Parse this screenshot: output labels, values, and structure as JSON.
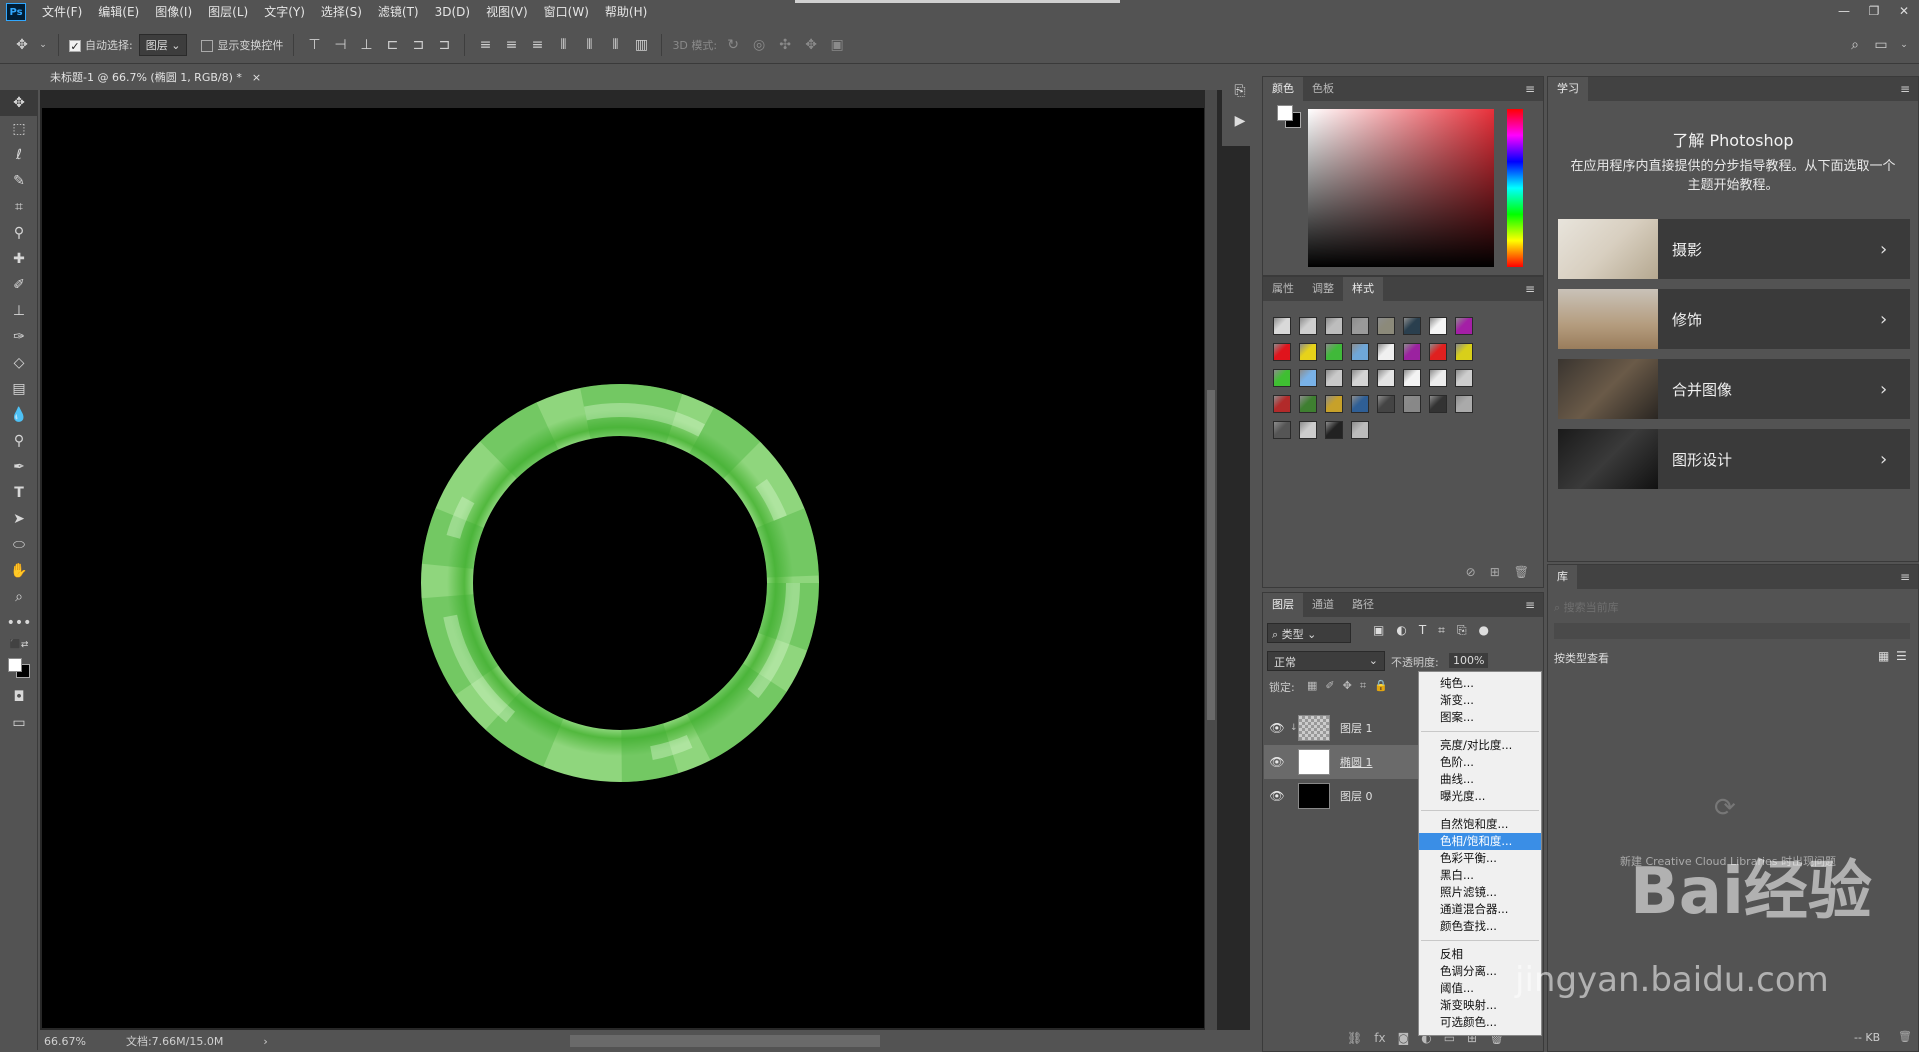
{
  "app": {
    "logo": "Ps",
    "window_controls": [
      "—",
      "❐",
      "✕"
    ]
  },
  "menu": [
    "文件(F)",
    "编辑(E)",
    "图像(I)",
    "图层(L)",
    "文字(Y)",
    "选择(S)",
    "滤镜(T)",
    "3D(D)",
    "视图(V)",
    "窗口(W)",
    "帮助(H)"
  ],
  "options": {
    "auto_select_label": "自动选择:",
    "auto_select_value": "图层",
    "show_transform_label": "显示变换控件",
    "mode_3d_label": "3D 模式:"
  },
  "document": {
    "tab_title": "未标题-1 @ 66.7% (椭圆 1, RGB/8) *",
    "tab_close": "×",
    "zoom": "66.67%",
    "doc_info": "文档:7.66M/15.0M"
  },
  "color_panel": {
    "tabs": [
      "颜色",
      "色板"
    ]
  },
  "styles_panel": {
    "tabs": [
      "属性",
      "调整",
      "样式"
    ]
  },
  "learn_panel": {
    "tab": "学习",
    "heading": "了解 Photoshop",
    "description": "在应用程序内直接提供的分步指导教程。从下面选取一个主题开始教程。",
    "topics": [
      {
        "title": "摄影",
        "icon": "chevron-right-icon"
      },
      {
        "title": "修饰",
        "icon": "chevron-right-icon"
      },
      {
        "title": "合并图像",
        "icon": "chevron-right-icon"
      },
      {
        "title": "图形设计",
        "icon": "chevron-right-icon"
      }
    ]
  },
  "library_panel": {
    "tab": "库",
    "search_placeholder": "搜索当前库",
    "view_by_type": "按类型查看",
    "cc_message": "新建 Creative Cloud Libraries 时出现问题",
    "size": "-- KB"
  },
  "layers_panel": {
    "tabs": [
      "图层",
      "通道",
      "路径"
    ],
    "filter_kind": "类型",
    "blend_mode": "正常",
    "opacity_label": "不透明度:",
    "opacity_value": "100%",
    "lock_label": "锁定:",
    "layers": [
      {
        "name": "图层 1",
        "visible": true
      },
      {
        "name": "椭圆 1",
        "visible": true
      },
      {
        "name": "图层 0",
        "visible": true
      }
    ]
  },
  "adjustment_menu": {
    "groups": [
      [
        "纯色...",
        "渐变...",
        "图案..."
      ],
      [
        "亮度/对比度...",
        "色阶...",
        "曲线...",
        "曝光度..."
      ],
      [
        "自然饱和度...",
        "色相/饱和度...",
        "色彩平衡...",
        "黑白...",
        "照片滤镜...",
        "通道混合器...",
        "颜色查找..."
      ],
      [
        "反相",
        "色调分离...",
        "阈值...",
        "渐变映射...",
        "可选颜色..."
      ]
    ],
    "highlighted": "色相/饱和度..."
  },
  "watermark": {
    "brand": "Bai经验",
    "url": "jingyan.baidu.com"
  }
}
